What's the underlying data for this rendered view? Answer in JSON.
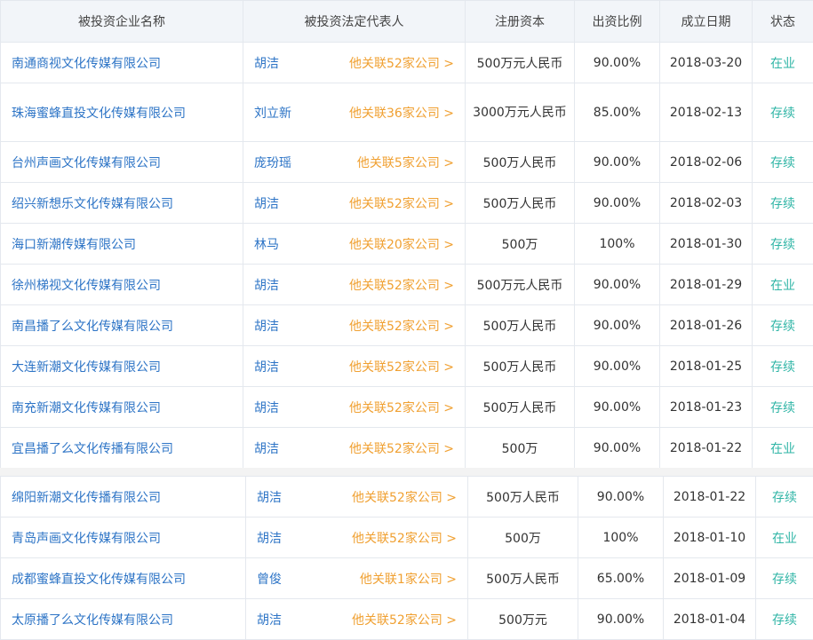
{
  "headers": {
    "company": "被投资企业名称",
    "legal_rep": "被投资法定代表人",
    "capital": "注册资本",
    "ratio": "出资比例",
    "date": "成立日期",
    "status": "状态"
  },
  "rows": [
    {
      "company": "南通商视文化传媒有限公司",
      "legal_rep": "胡洁",
      "related": "他关联52家公司 >",
      "capital": "500万元人民币",
      "ratio": "90.00%",
      "date": "2018-03-20",
      "status": "在业"
    },
    {
      "company": "珠海蜜蜂直投文化传媒有限公司",
      "legal_rep": "刘立新",
      "related": "他关联36家公司 >",
      "capital": "3000万元人民币",
      "ratio": "85.00%",
      "date": "2018-02-13",
      "status": "存续"
    },
    {
      "company": "台州声画文化传媒有限公司",
      "legal_rep": "庞玢瑶",
      "related": "他关联5家公司 >",
      "capital": "500万人民币",
      "ratio": "90.00%",
      "date": "2018-02-06",
      "status": "存续"
    },
    {
      "company": "绍兴新想乐文化传媒有限公司",
      "legal_rep": "胡洁",
      "related": "他关联52家公司 >",
      "capital": "500万人民币",
      "ratio": "90.00%",
      "date": "2018-02-03",
      "status": "存续"
    },
    {
      "company": "海口新潮传媒有限公司",
      "legal_rep": "林马",
      "related": "他关联20家公司 >",
      "capital": "500万",
      "ratio": "100%",
      "date": "2018-01-30",
      "status": "存续"
    },
    {
      "company": "徐州梯视文化传媒有限公司",
      "legal_rep": "胡洁",
      "related": "他关联52家公司 >",
      "capital": "500万元人民币",
      "ratio": "90.00%",
      "date": "2018-01-29",
      "status": "在业"
    },
    {
      "company": "南昌播了么文化传媒有限公司",
      "legal_rep": "胡洁",
      "related": "他关联52家公司 >",
      "capital": "500万人民币",
      "ratio": "90.00%",
      "date": "2018-01-26",
      "status": "存续"
    },
    {
      "company": "大连新潮文化传媒有限公司",
      "legal_rep": "胡洁",
      "related": "他关联52家公司 >",
      "capital": "500万人民币",
      "ratio": "90.00%",
      "date": "2018-01-25",
      "status": "存续"
    },
    {
      "company": "南充新潮文化传媒有限公司",
      "legal_rep": "胡洁",
      "related": "他关联52家公司 >",
      "capital": "500万人民币",
      "ratio": "90.00%",
      "date": "2018-01-23",
      "status": "存续"
    },
    {
      "company": "宜昌播了么文化传播有限公司",
      "legal_rep": "胡洁",
      "related": "他关联52家公司 >",
      "capital": "500万",
      "ratio": "90.00%",
      "date": "2018-01-22",
      "status": "在业"
    },
    {
      "company": "绵阳新潮文化传播有限公司",
      "legal_rep": "胡洁",
      "related": "他关联52家公司 >",
      "capital": "500万人民币",
      "ratio": "90.00%",
      "date": "2018-01-22",
      "status": "存续"
    },
    {
      "company": "青岛声画文化传媒有限公司",
      "legal_rep": "胡洁",
      "related": "他关联52家公司 >",
      "capital": "500万",
      "ratio": "100%",
      "date": "2018-01-10",
      "status": "在业"
    },
    {
      "company": "成都蜜蜂直投文化传媒有限公司",
      "legal_rep": "曾俊",
      "related": "他关联1家公司 >",
      "capital": "500万人民币",
      "ratio": "65.00%",
      "date": "2018-01-09",
      "status": "存续"
    },
    {
      "company": "太原播了么文化传媒有限公司",
      "legal_rep": "胡洁",
      "related": "他关联52家公司 >",
      "capital": "500万元",
      "ratio": "90.00%",
      "date": "2018-01-04",
      "status": "存续"
    }
  ],
  "colors": {
    "link_blue": "#2d74c6",
    "related_orange": "#f0a031",
    "status_teal": "#2fb5a6",
    "header_bg": "#f2f5f9"
  }
}
